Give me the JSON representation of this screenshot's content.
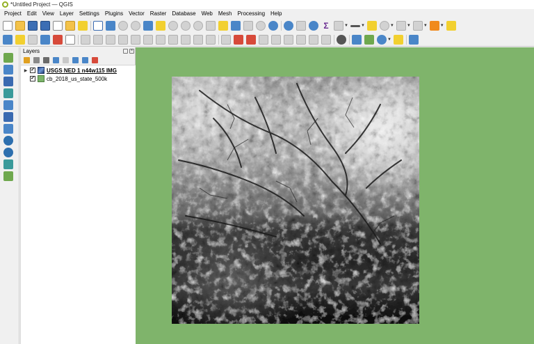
{
  "window": {
    "title": "*Untitled Project — QGIS"
  },
  "menubar": {
    "items": [
      "Project",
      "Edit",
      "View",
      "Layer",
      "Settings",
      "Plugins",
      "Vector",
      "Raster",
      "Database",
      "Web",
      "Mesh",
      "Processing",
      "Help"
    ]
  },
  "layers_panel": {
    "title": "Layers",
    "layers": [
      {
        "name": "USGS NED 1 n44w115 IMG",
        "type": "raster",
        "checked": true,
        "active": true,
        "icon": "raster-layer-icon"
      },
      {
        "name": "cb_2018_us_state_500k",
        "type": "vector",
        "checked": true,
        "active": false,
        "icon": "polygon-layer-icon"
      }
    ]
  },
  "colors": {
    "canvas_background": "#7fb46b",
    "vector_fill": "#7cb46a",
    "qgis_brand": "#93b023"
  },
  "icons": {
    "toolbar1": [
      "new-project-icon",
      "open-project-icon",
      "save-project-icon",
      "save-as-icon",
      "new-print-layout-icon",
      "layout-manager-icon",
      "style-manager-icon",
      "pan-icon",
      "pan-to-selection-icon",
      "zoom-in-icon",
      "zoom-out-icon",
      "zoom-full-icon",
      "zoom-to-selection-icon",
      "zoom-to-layer-icon",
      "zoom-native-icon",
      "zoom-last-icon",
      "zoom-next-icon",
      "new-map-view-icon",
      "new-3d-view-icon",
      "temporal-controller-icon",
      "refresh-icon",
      "identify-icon",
      "attribute-table-icon",
      "settings-icon",
      "statistics-icon",
      "measure-icon",
      "annotation-icon",
      "label-icon",
      "text-annotation-icon",
      "select-features-icon",
      "deselect-icon"
    ],
    "toolbar2": [
      "data-source-manager-icon",
      "new-geopackage-icon",
      "digitize-icon",
      "current-edits-icon",
      "toggle-editing-icon",
      "save-edits-icon",
      "add-feature-icon",
      "vertex-tool-icon",
      "delete-selected-icon",
      "cut-features-icon",
      "copy-features-icon",
      "paste-features-icon",
      "undo-icon",
      "redo-icon",
      "label-toolbar-icon",
      "pin-label-icon",
      "show-hide-labels-icon",
      "move-label-icon",
      "rotate-label-icon",
      "change-label-icon",
      "quick-osm-icon",
      "python-console-icon",
      "plugin-icon",
      "help-icon"
    ],
    "left_toolbar": [
      "add-vector-layer-icon",
      "add-raster-layer-icon",
      "add-mesh-layer-icon",
      "add-delimited-text-icon",
      "add-postgis-icon",
      "add-spatialite-icon",
      "add-virtual-layer-icon",
      "add-wms-icon",
      "add-wfs-icon",
      "add-wcs-icon",
      "add-vector-tile-icon"
    ]
  }
}
